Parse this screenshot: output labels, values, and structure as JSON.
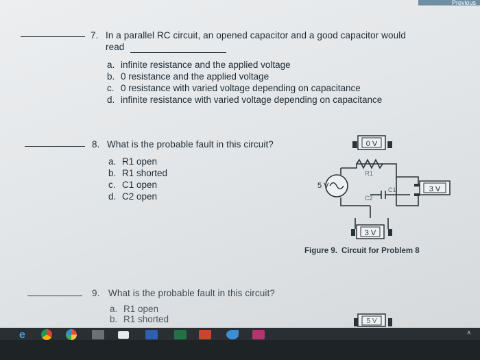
{
  "top_button": {
    "label": "Previous"
  },
  "q7": {
    "number": "7.",
    "line1": "In a parallel RC circuit, an opened capacitor and a good capacitor would",
    "line2": "read",
    "options": [
      {
        "letter": "a.",
        "text": "infinite resistance and the applied voltage"
      },
      {
        "letter": "b.",
        "text": "0 resistance and the applied voltage"
      },
      {
        "letter": "c.",
        "text": "0 resistance with varied voltage depending on capacitance"
      },
      {
        "letter": "d.",
        "text": "infinite resistance with varied voltage depending on capacitance"
      }
    ]
  },
  "q8": {
    "number": "8.",
    "text": "What is the probable fault in this circuit?",
    "options": [
      {
        "letter": "a.",
        "text": "R1 open"
      },
      {
        "letter": "b.",
        "text": "R1 shorted"
      },
      {
        "letter": "c.",
        "text": "C1 open"
      },
      {
        "letter": "d.",
        "text": "C2 open"
      }
    ]
  },
  "figure9": {
    "meter_top": "0 V",
    "meter_right": "3 V",
    "meter_bottom": "3 V",
    "resistor_label": "R1",
    "source_label": "5 V",
    "c1_label": "C1",
    "c2_label": "C2",
    "caption_number": "Figure 9.",
    "caption_text": "Circuit for Problem 8"
  },
  "q9": {
    "number": "9.",
    "text": "What is the probable fault in this circuit?",
    "options": [
      {
        "letter": "a.",
        "text": "R1 open"
      },
      {
        "letter": "b.",
        "text": "R1 shorted"
      }
    ],
    "meter_partial": "5 V"
  },
  "taskbar": {
    "icons": [
      "edge-icon",
      "chrome-icon",
      "pinwheel-icon",
      "store-icon",
      "mail-icon",
      "word-icon",
      "excel-icon",
      "powerpoint-icon",
      "bird-icon",
      "photos-icon"
    ],
    "tray_text": "ᴬ"
  }
}
